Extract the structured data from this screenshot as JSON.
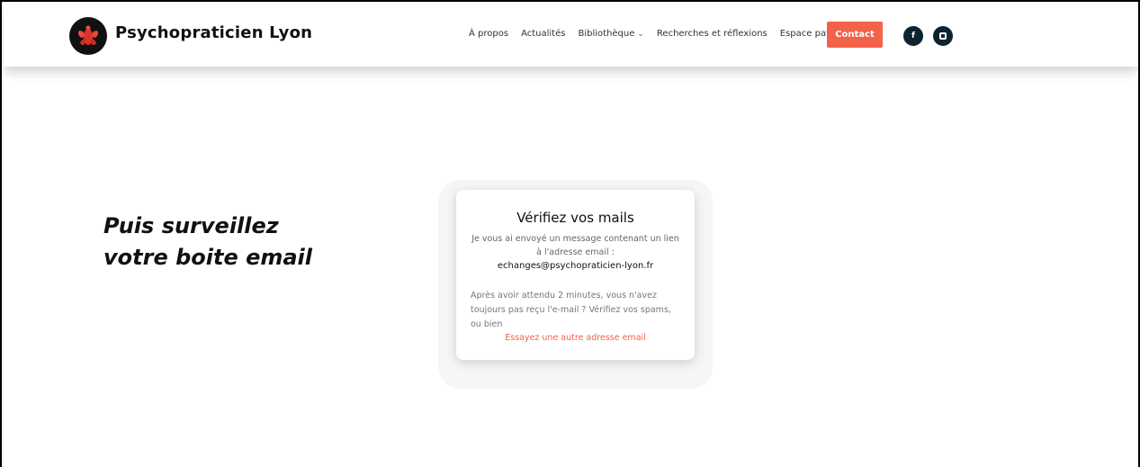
{
  "header": {
    "brand": "Psychopraticien Lyon",
    "logo_icon": "red-cicada-logo",
    "nav": [
      {
        "label": "À propos"
      },
      {
        "label": "Actualités"
      },
      {
        "label": "Bibliothèque",
        "has_dropdown": true
      },
      {
        "label": "Recherches et réflexions"
      },
      {
        "label": "Espace patient"
      }
    ],
    "contact_label": "Contact",
    "social": {
      "facebook_glyph": "f",
      "facebook_icon": "facebook-icon",
      "instagram_icon": "instagram-icon"
    }
  },
  "caption": {
    "line1": "Puis surveillez",
    "line2": "votre boite email"
  },
  "card": {
    "title": "Vérifiez vos mails",
    "message": "Je vous ai envoyé un message contenant un lien à l'adresse email :",
    "email": "echanges@psychopraticien-lyon.fr",
    "wait_text": "Après avoir attendu 2 minutes, vous n'avez toujours pas reçu l'e-mail ? Vérifiez vos spams, ou bien",
    "retry_link": "Essayez une autre adresse email"
  },
  "colors": {
    "accent": "#f2624a",
    "social_bg": "#0e2330",
    "logo_bg": "#111111"
  }
}
